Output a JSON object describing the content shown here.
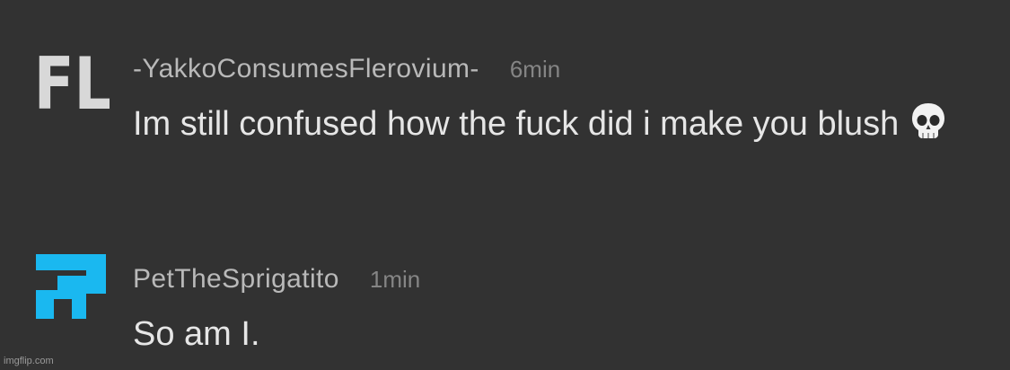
{
  "comments": [
    {
      "avatar": {
        "icon": "fl-text-avatar-icon",
        "text": "FL",
        "color": "#d8d8d8"
      },
      "username": "-YakkoConsumesFlerovium-",
      "time": "6min",
      "text": "Im still confused how the fuck did i make you blush",
      "emoji": "skull-emoji-icon"
    },
    {
      "avatar": {
        "icon": "blue-pixel-logo-icon",
        "color": "#1ab8f0"
      },
      "username": "PetTheSprigatito",
      "time": "1min",
      "text": "So am I."
    }
  ],
  "watermark": "imgflip.com"
}
